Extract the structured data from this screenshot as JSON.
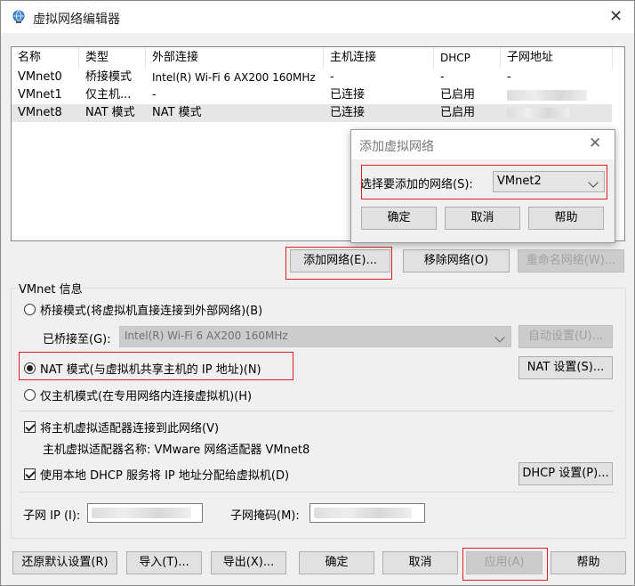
{
  "window": {
    "title": "虚拟网络编辑器"
  },
  "table": {
    "headers": [
      "名称",
      "类型",
      "外部连接",
      "主机连接",
      "DHCP",
      "子网地址"
    ],
    "rows": [
      {
        "name": "VMnet0",
        "type": "桥接模式",
        "external": "Intel(R) Wi-Fi 6 AX200 160MHz",
        "host": "-",
        "dhcp": "-",
        "subnet": "-"
      },
      {
        "name": "VMnet1",
        "type": "仅主机...",
        "external": "-",
        "host": "已连接",
        "dhcp": "已启用",
        "subnet": ""
      },
      {
        "name": "VMnet8",
        "type": "NAT 模式",
        "external": "NAT 模式",
        "host": "已连接",
        "dhcp": "已启用",
        "subnet": ""
      }
    ]
  },
  "network_buttons": {
    "add": "添加网络(E)...",
    "remove": "移除网络(O)",
    "rename": "重命名网络(W)..."
  },
  "vmnet_info": {
    "legend": "VMnet 信息",
    "bridged_label": "桥接模式(将虚拟机直接连接到外部网络)(B)",
    "bridged_to_label": "已桥接至(G):",
    "bridged_to_value": "Intel(R) Wi-Fi 6 AX200 160MHz",
    "auto_settings": "自动设置(U)...",
    "nat_label": "NAT 模式(与虚拟机共享主机的 IP 地址)(N)",
    "nat_settings": "NAT 设置(S)...",
    "hostonly_label": "仅主机模式(在专用网络内连接虚拟机)(H)",
    "connect_adapter_label": "将主机虚拟适配器连接到此网络(V)",
    "adapter_name_label": "主机虚拟适配器名称: VMware 网络适配器 VMnet8",
    "dhcp_label": "使用本地 DHCP 服务将 IP 地址分配给虚拟机(D)",
    "dhcp_settings": "DHCP 设置(P)...",
    "subnet_ip_label": "子网 IP (I):",
    "subnet_mask_label": "子网掩码(M):"
  },
  "bottom_buttons": {
    "restore": "还原默认设置(R)",
    "import": "导入(T)...",
    "export": "导出(X)...",
    "ok": "确定",
    "cancel": "取消",
    "apply": "应用(A)",
    "help": "帮助"
  },
  "dialog": {
    "title": "添加虚拟网络",
    "select_label": "选择要添加的网络(S):",
    "select_value": "VMnet2",
    "ok": "确定",
    "cancel": "取消",
    "help": "帮助"
  },
  "colors": {
    "highlight_box": "#e02020",
    "selected_row": "#e6e6e6",
    "disabled_bg": "#cccccc"
  },
  "icons": {
    "title": "network-globe-icon",
    "close": "close-icon"
  }
}
